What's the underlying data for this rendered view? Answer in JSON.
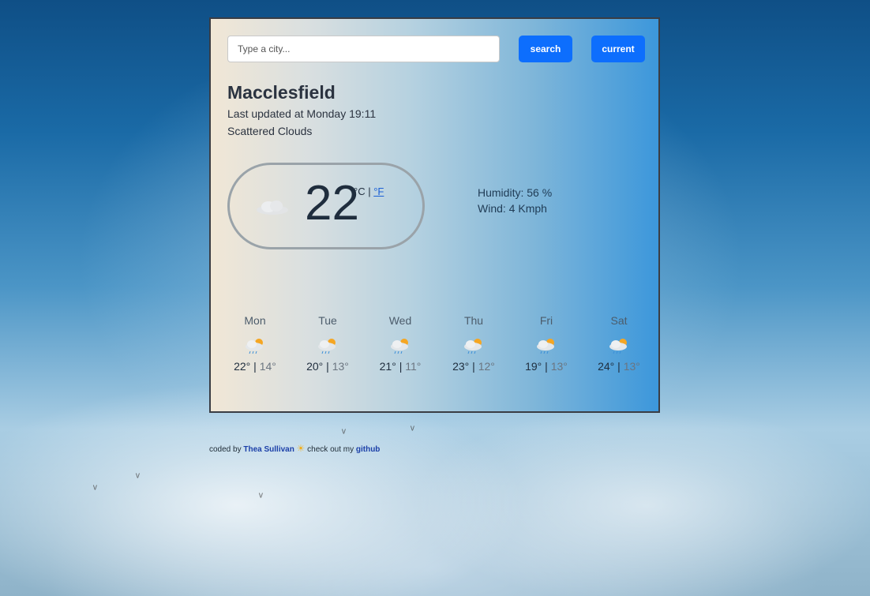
{
  "search": {
    "placeholder": "Type a city...",
    "search_label": "search",
    "current_label": "current"
  },
  "current": {
    "city": "Macclesfield",
    "updated": "Last updated at Monday 19:11",
    "description": "Scattered Clouds",
    "temperature": "22",
    "unit_c": "°C",
    "unit_separator": "|",
    "unit_f": "°F",
    "humidity": "Humidity: 56 %",
    "wind": "Wind: 4 Kmph",
    "icon": "cloud-icon"
  },
  "forecast": [
    {
      "day": "Mon",
      "max": "22°",
      "min": "14°",
      "icon": "rain-sun-cloud-icon"
    },
    {
      "day": "Tue",
      "max": "20°",
      "min": "13°",
      "icon": "rain-sun-cloud-icon"
    },
    {
      "day": "Wed",
      "max": "21°",
      "min": "11°",
      "icon": "rain-sun-cloud-icon"
    },
    {
      "day": "Thu",
      "max": "23°",
      "min": "12°",
      "icon": "rain-sun-cloud-icon"
    },
    {
      "day": "Fri",
      "max": "19°",
      "min": "13°",
      "icon": "rain-sun-cloud-icon"
    },
    {
      "day": "Sat",
      "max": "24°",
      "min": "13°",
      "icon": "rain-sun-cloud-icon"
    }
  ],
  "forecast_separator": "|",
  "footer": {
    "prefix": "coded by",
    "author": "Thea Sullivan",
    "middle": "check out my",
    "link": "github"
  },
  "colors": {
    "accent": "#0d6efd",
    "border": "#3a3d44"
  }
}
